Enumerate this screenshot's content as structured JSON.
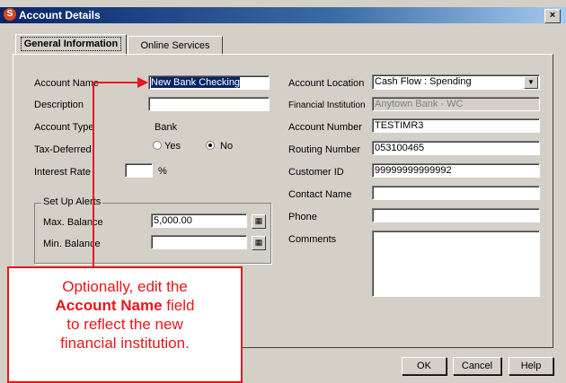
{
  "window": {
    "title": "Account Details",
    "close": "×"
  },
  "tabs": [
    {
      "label": "General Information"
    },
    {
      "label": "Online Services"
    }
  ],
  "left": {
    "account_name": {
      "label": "Account Name",
      "value": "New Bank Checking"
    },
    "description": {
      "label": "Description",
      "value": ""
    },
    "account_type": {
      "label": "Account Type",
      "value": "Bank"
    },
    "tax_deferred": {
      "label": "Tax-Deferred",
      "yes": "Yes",
      "no": "No",
      "selected": "No"
    },
    "interest_rate": {
      "label": "Interest Rate",
      "value": "",
      "unit": "%"
    },
    "alerts": {
      "title": "Set Up Alerts",
      "max_label": "Max. Balance",
      "max_value": "5,000.00",
      "min_label": "Min. Balance",
      "min_value": ""
    }
  },
  "right": {
    "account_location": {
      "label": "Account Location",
      "value": "Cash Flow : Spending"
    },
    "financial_institution": {
      "label": "Financial Institution",
      "value": "Anytown Bank - WC"
    },
    "account_number": {
      "label": "Account Number",
      "value": "TESTIMR3"
    },
    "routing_number": {
      "label": "Routing Number",
      "value": "053100465"
    },
    "customer_id": {
      "label": "Customer ID",
      "value": "99999999999992"
    },
    "contact_name": {
      "label": "Contact Name",
      "value": ""
    },
    "phone": {
      "label": "Phone",
      "value": ""
    },
    "comments": {
      "label": "Comments",
      "value": ""
    }
  },
  "buttons": {
    "ok": "OK",
    "cancel": "Cancel",
    "help": "Help"
  },
  "callout": {
    "line1": "Optionally, edit the",
    "bold": "Account Name",
    "line2": " field",
    "line3": "to reflect the new",
    "line4": "financial institution."
  },
  "colors": {
    "accent": "#e8161b",
    "title_bar": "#0a246a"
  }
}
